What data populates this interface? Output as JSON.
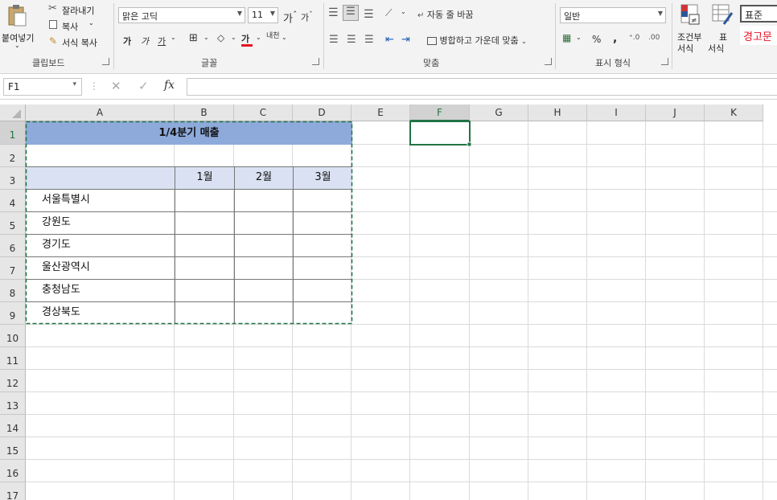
{
  "ribbon": {
    "clipboard": {
      "paste_label": "붙여넣기",
      "cut_label": "잘라내기",
      "copy_label": "복사",
      "format_painter_label": "서식 복사",
      "group_label": "클립보드"
    },
    "font": {
      "font_name": "맑은 고딕",
      "font_size": "11",
      "grow_label": "가",
      "shrink_label": "가",
      "bold_label": "가",
      "italic_label": "가",
      "underline_label": "가",
      "font_color_label": "가",
      "phonetic_label": "내천",
      "font_color_hex": "#e81123",
      "group_label": "글꼴"
    },
    "alignment": {
      "wrap_text_label": "자동 줄 바꿈",
      "merge_center_label": "병합하고 가운데 맞춤",
      "group_label": "맞춤"
    },
    "number": {
      "format_value": "일반",
      "percent_label": "%",
      "comma_label": ",",
      "group_label": "표시 형식"
    },
    "styles": {
      "conditional_label_1": "조건부",
      "conditional_label_2": "서식",
      "table_label_1": "표",
      "table_label_2": "서식",
      "style_normal": "표준",
      "style_warning": "경고문",
      "style_warning_color": "#e81123"
    }
  },
  "formula_bar": {
    "name_box": "F1",
    "fx_label": "fx",
    "formula_value": ""
  },
  "sheet": {
    "columns": [
      "A",
      "B",
      "C",
      "D",
      "E",
      "F",
      "G",
      "H",
      "I",
      "J",
      "K"
    ],
    "selected_column": "F",
    "rows": [
      "1",
      "2",
      "3",
      "4",
      "5",
      "6",
      "7",
      "8",
      "9",
      "10",
      "11",
      "12",
      "13",
      "14",
      "15",
      "16",
      "17"
    ],
    "selected_row": "1",
    "title": "1/4분기 매출",
    "month_headers": [
      "1월",
      "2월",
      "3월"
    ],
    "regions": [
      "서울특별시",
      "강원도",
      "경기도",
      "울산광역시",
      "충청남도",
      "경상북도"
    ],
    "title_fill": "#8eaadb",
    "header_fill": "#d9e1f2",
    "selection_color": "#217346"
  }
}
